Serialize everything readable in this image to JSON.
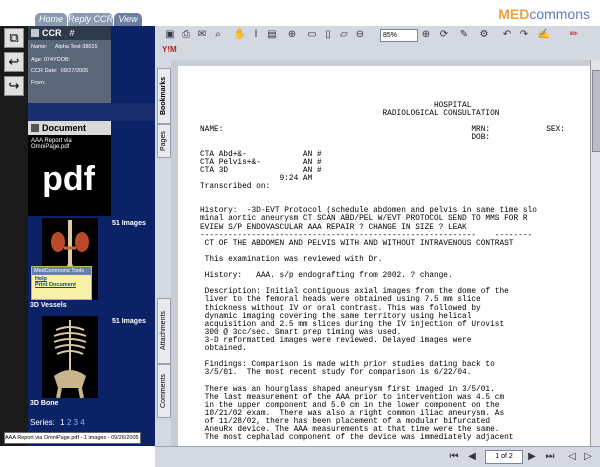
{
  "tabs": [
    "Home",
    "Reply CCR",
    "View"
  ],
  "logo": {
    "med": "MED",
    "commons": "commons"
  },
  "ccr": {
    "title": "CCR",
    "hash": "#",
    "rows": [
      {
        "label": "Name:",
        "value": "Alpha Test-38615"
      },
      {
        "label": "Age:",
        "value": "074Y"
      },
      {
        "label": "DOB:",
        "value": ""
      },
      {
        "label": "CCR Date:",
        "value": "09/27/2005"
      },
      {
        "label": "From:",
        "value": ""
      }
    ]
  },
  "document": {
    "title": "Document",
    "text": "AAA Report via OmniPage.pdf",
    "pdf": "pdf"
  },
  "images": [
    {
      "count": "51 Images",
      "label": "3D Vessels"
    },
    {
      "count": "51 Images",
      "label": "3D Bone"
    }
  ],
  "tools": {
    "title": "MedCommons Tools",
    "help": "Help",
    "print": "Print Document"
  },
  "series": {
    "label": "Series:",
    "pages": [
      "1",
      "2",
      "3",
      "4"
    ]
  },
  "select": {
    "value": "AAA Report via OmniPage.pdf - 1 images - 09/26/2005"
  },
  "viewer": {
    "zoom": "85%",
    "page": "1 of 2",
    "side_tabs": [
      "Bookmarks",
      "Pages",
      "Attachments",
      "Comments"
    ],
    "lines": [
      "                                                  HOSPITAL",
      "                                       RADIOLOGICAL CONSULTATION",
      "",
      "NAME:                                                     MRN:            SEX:",
      "                                                          DOB:",
      "",
      "CTA Abd+&-            AN #",
      "CTA Pelvis+&-         AN #",
      "CTA 3D                AN #",
      "                 9:24 AM",
      "Transcribed on:",
      "",
      "",
      "History:  -3D-EVT Protocol (schedule abdomen and pelvis in same time slo",
      "minal aortic aneurysm CT SCAN ABD/PEL W/EVT PROTOCOL SEND TO MMS FOR R",
      "EVIEW S/P ENDOVASCULAR AAA REPAIR ? CHANGE IN SIZE ? LEAK",
      "-----------------------------------------------------------    --------",
      " CT OF THE ABDOMEN AND PELVIS WITH AND WITHOUT INTRAVENOUS CONTRAST",
      "",
      " This examination was reviewed with Dr.",
      "",
      " History:   AAA. s/p endografting from 2002. ? change.",
      "",
      " Description: Initial contiguous axial images from the dome of the",
      " liver to the femoral heads were obtained using 7.5 mm slice",
      " thickness without IV or oral contrast. This was followed by",
      " dynamic imaging covering the same territory using helical",
      " acquisition and 2.5 mm slices during the IV injection of Urovist",
      " 300 @ 3cc/sec. Smart prep timing was used.",
      " 3-D reformatted images were reviewed. Delayed images were",
      " obtained.",
      "",
      " Findings: Comparison is made with prior studies dating back to",
      " 3/5/01.  The most recent study for comparison is 6/22/04.",
      "",
      " There was an hourglass shaped aneurysm first imaged in 3/5/01.",
      " The last measurement of the AAA prior to intervention was 4.5 cm",
      " in the upper component and 5.0 cm in the lower component on the",
      " 10/21/02 exam.  There was also a right common iliac aneurysm. As",
      " of 11/28/02, there has been placement of a modular bifurcated",
      " AneuRx device. The AAA measurements at that time were the same.",
      " The most cephalad component of the device was immediately adjacent"
    ]
  }
}
